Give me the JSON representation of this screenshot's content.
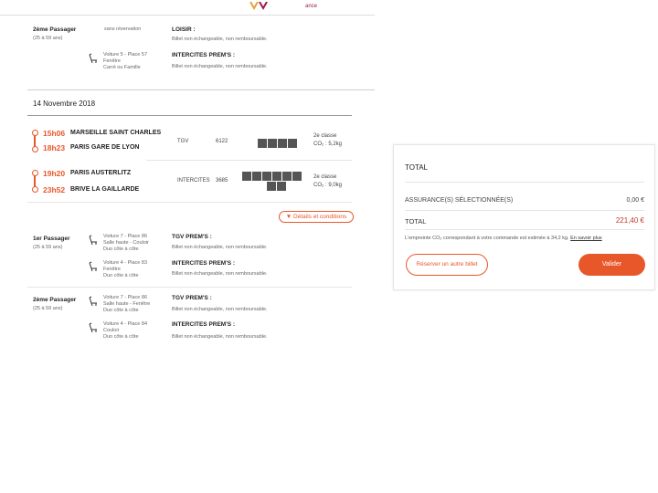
{
  "brand_text": "ance",
  "top_passenger": {
    "label": "2ème Passager",
    "age": "(25 à 59 ans)",
    "note": "sans réservation",
    "fare1_title": "LOISIR :",
    "fare1_text": "Billet non échangeable, non remboursable.",
    "seat_line1": "Voiture 5 - Place 57",
    "seat_line2": "Fenêtre",
    "seat_line3": "Carré ou Famille",
    "fare2_title": "INTERCITES PREM'S :",
    "fare2_text": "Billet non échangeable, non remboursable."
  },
  "date": "14 Novembre 2018",
  "journey": {
    "seg1": {
      "dep_time": "15h06",
      "dep_station": "MARSEILLE SAINT CHARLES",
      "arr_time": "18h23",
      "arr_station": "PARIS GARE DE LYON",
      "train": "TGV",
      "number": "6122",
      "class": "2e classe",
      "co2": "CO₂ : 5,2kg"
    },
    "seg2": {
      "dep_time": "19h20",
      "dep_station": "PARIS AUSTERLITZ",
      "arr_time": "23h52",
      "arr_station": "BRIVE LA GAILLARDE",
      "train": "INTERCITES",
      "number": "3685",
      "class": "2e classe",
      "co2": "CO₂ : 9,0kg"
    },
    "details_link": "Détails et conditions"
  },
  "passengers": [
    {
      "label": "1er Passager",
      "age": "(25 à 59 ans)",
      "seat1": [
        "Voiture 7 - Place 86",
        "Salle haute - Couloir",
        "Duo côte à côte"
      ],
      "fare1_title": "TGV PREM'S :",
      "fare1_text": "Billet non échangeable, non remboursable.",
      "seat2": [
        "Voiture 4 - Place 83",
        "Fenêtre",
        "Duo côte à côte"
      ],
      "fare2_title": "INTERCITES PREM'S :",
      "fare2_text": "Billet non échangeable, non remboursable."
    },
    {
      "label": "2ème Passager",
      "age": "(25 à 59 ans)",
      "seat1": [
        "Voiture 7 - Place 86",
        "Salle haute - Fenêtre",
        "Duo côte à côte"
      ],
      "fare1_title": "TGV PREM'S :",
      "fare1_text": "Billet non échangeable, non remboursable.",
      "seat2": [
        "Voiture 4 - Place 84",
        "Couloir",
        "Duo côte à côte"
      ],
      "fare2_title": "INTERCITES PREM'S :",
      "fare2_text": "Billet non échangeable, non remboursable."
    }
  ],
  "total_panel": {
    "title": "TOTAL",
    "insurance_label": "ASSURANCE(S) SÉLECTIONNÉE(S)",
    "insurance_value": "0,00 €",
    "total_label": "TOTAL",
    "total_value": "221,40 €",
    "co2_text": "L'empreinte CO₂ correspondant à votre commande est estimée à 34,2 kg.",
    "co2_link": "En savoir plus",
    "reserve_button": "Réserver un autre billet",
    "validate_button": "Valider"
  },
  "colors": {
    "accent": "#e8572a",
    "price": "#c0392b"
  }
}
